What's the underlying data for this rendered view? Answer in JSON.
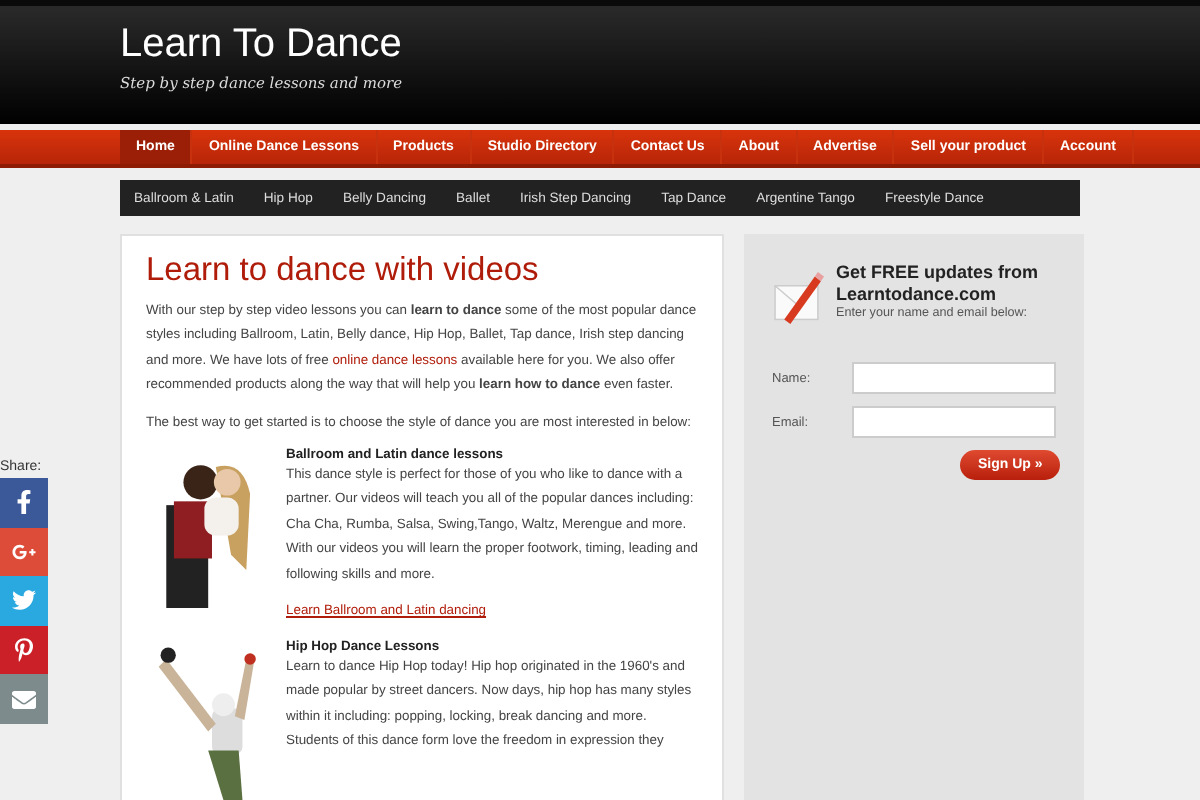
{
  "site": {
    "title": "Learn To Dance",
    "tagline": "Step by step dance lessons and more"
  },
  "main_nav": [
    {
      "label": "Home",
      "selected": true
    },
    {
      "label": "Online Dance Lessons",
      "selected": false
    },
    {
      "label": "Products",
      "selected": false
    },
    {
      "label": "Studio Directory",
      "selected": false
    },
    {
      "label": "Contact Us",
      "selected": false
    },
    {
      "label": "About",
      "selected": false
    },
    {
      "label": "Advertise",
      "selected": false
    },
    {
      "label": "Sell your product",
      "selected": false
    },
    {
      "label": "Account",
      "selected": false
    }
  ],
  "sub_nav": [
    "Ballroom & Latin",
    "Hip Hop",
    "Belly Dancing",
    "Ballet",
    "Irish Step Dancing",
    "Tap Dance",
    "Argentine Tango",
    "Freestyle Dance"
  ],
  "article": {
    "heading": "Learn to dance with videos",
    "intro": [
      "With our step by step video lessons you can **learn to dance** some of the most popular dance styles including Ballroom, Latin, Belly dance, Hip Hop, Ballet, Tap dance, Irish step dancing and more. We have lots of free ",
      "online dance lessons",
      " available here for you. We also offer recommended products along the way that will help you **learn how to dance** even faster."
    ],
    "lead": "The best way to get started is to choose the style of dance you are most interested in below:",
    "styles": [
      {
        "title": "Ballroom and Latin dance lessons",
        "text": "This dance style is perfect for those of you who like to dance with a partner. Our videos will teach you all of the popular dances including: Cha Cha, Rumba, Salsa, Swing,Tango, Waltz, Merengue and more. With our videos you will learn the proper footwork, timing, leading and following skills and more.",
        "link": "Learn Ballroom and Latin dancing"
      },
      {
        "title": "Hip Hop Dance Lessons",
        "text": "Learn to dance Hip Hop today! Hip hop originated in the 1960's and made popular by street dancers. Now days, hip hop has many styles within it including: popping, locking, break dancing and more. Students of this dance form love the freedom in expression they"
      }
    ]
  },
  "signup": {
    "heading": "Get FREE updates from Learntodance.com",
    "subheading": "Enter your name and email below:",
    "fields": [
      {
        "label": "Name:"
      },
      {
        "label": "Email:"
      }
    ],
    "button": "Sign Up »"
  },
  "share": {
    "label": "Share:",
    "buttons": [
      {
        "kind": "facebook",
        "color": "#3b5998"
      },
      {
        "kind": "googleplus",
        "color": "#dd4b39"
      },
      {
        "kind": "twitter",
        "color": "#29a9e0"
      },
      {
        "kind": "pinterest",
        "color": "#cb2027"
      },
      {
        "kind": "email",
        "color": "#7d8b8c"
      }
    ]
  }
}
